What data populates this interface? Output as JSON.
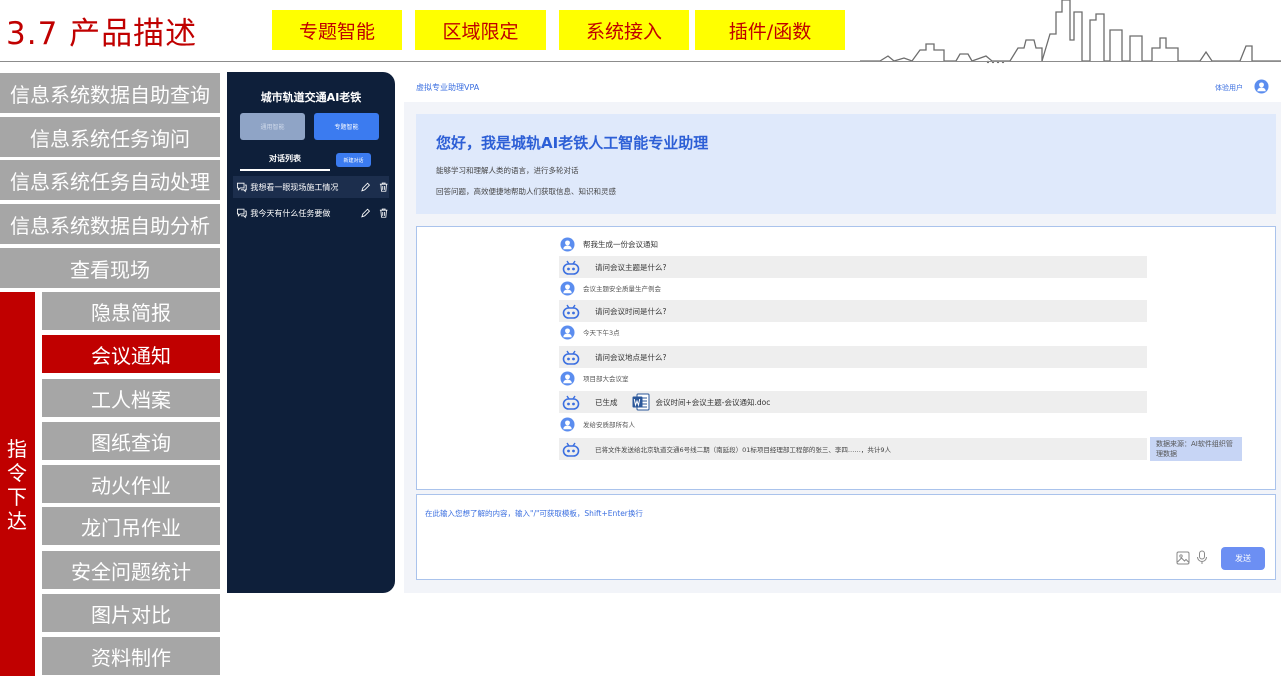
{
  "slide": {
    "title": "3.7 产品描述",
    "tags": [
      "专题智能",
      "区域限定",
      "系统接入",
      "插件/函数"
    ],
    "accent_red": "#c00000",
    "tag_yellow": "#ffff00",
    "menu_gray": "#a6a6a6"
  },
  "menu": {
    "items": [
      "信息系统数据自助查询",
      "信息系统任务询问",
      "信息系统任务自动处理",
      "信息系统数据自助分析",
      "查看现场"
    ],
    "command_label": "指令下达",
    "sub_items": [
      "隐患简报",
      "会议通知",
      "工人档案",
      "图纸查询",
      "动火作业",
      "龙门吊作业",
      "安全问题统计",
      "图片对比",
      "资料制作"
    ],
    "active_sub": "会议通知"
  },
  "app": {
    "sidebar": {
      "title": "城市轨道交通AI老铁",
      "mode_general": "通用智能",
      "mode_special": "专题智能",
      "conv_tab": "对话列表",
      "new_chat": "新建对话",
      "conversations": [
        "我想看一眼现场施工情况",
        "我今天有什么任务要做"
      ]
    },
    "topbar": {
      "app_name": "虚拟专业助理VPA",
      "user_label": "体验用户"
    },
    "welcome": {
      "title": "您好，我是城轨AI老铁人工智能专业助理",
      "line1": "能够学习和理解人类的语言，进行多轮对话",
      "line2": "回答问题，高效便捷地帮助人们获取信息、知识和灵感"
    },
    "chat": {
      "u1": "帮我生成一份会议通知",
      "b1": "请问会议主题是什么?",
      "u2": "会议主题安全质量生产例会",
      "b2": "请问会议时间是什么?",
      "u3": "今天下午3点",
      "b3": "请问会议地点是什么?",
      "u4": "项目部大会议室",
      "b4_prefix": "已生成",
      "b4_file": "会议时间+会议主题-会议通知.doc",
      "u5": "发给安质部所有人",
      "b5": "已将文件发送给北京轨道交通6号线二期（南延段）01标项目经理部工程部的张三、李四……，共计9人",
      "source": "数据来源：AI软件组织管理数据"
    },
    "input": {
      "placeholder": "在此输入您想了解的内容，输入\"/\"可获取模板，Shift+Enter换行",
      "send": "发送"
    },
    "colors": {
      "sidebar_bg": "#0e1f3a",
      "primary_blue": "#3b7bf0",
      "send_blue": "#6c8ff3"
    }
  }
}
